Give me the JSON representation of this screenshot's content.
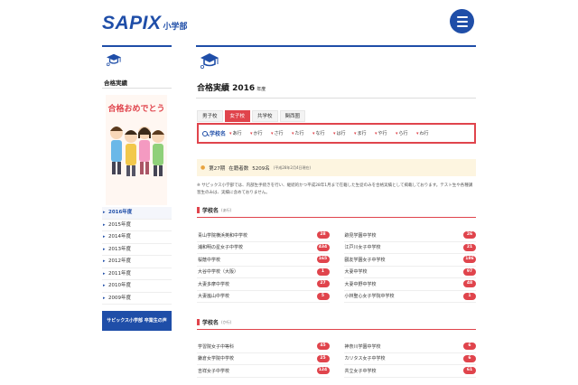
{
  "header": {
    "logo_main": "SAPIX",
    "logo_sub": "小学部",
    "menu_icon": "hamburger-menu-icon"
  },
  "sidebar": {
    "icon": "graduation-cap-icon",
    "title": "合格実績",
    "banner_text": "合格おめでとう",
    "years": [
      {
        "label": "2016年度",
        "active": true
      },
      {
        "label": "2015年度"
      },
      {
        "label": "2014年度"
      },
      {
        "label": "2013年度"
      },
      {
        "label": "2012年度"
      },
      {
        "label": "2011年度"
      },
      {
        "label": "2010年度"
      },
      {
        "label": "2009年度"
      }
    ],
    "voice_button": "サピックス小学部 卒業生の声"
  },
  "main": {
    "icon": "graduation-cap-icon",
    "title": "合格実績 2016",
    "title_suffix": "年度",
    "tabs": [
      {
        "label": "男子校"
      },
      {
        "label": "女子校",
        "active": true
      },
      {
        "label": "共学校"
      },
      {
        "label": "関西圏"
      }
    ],
    "search_label": "学校名",
    "rows": [
      "あ行",
      "か行",
      "さ行",
      "た行",
      "な行",
      "は行",
      "ま行",
      "や行",
      "ら行",
      "わ行"
    ],
    "info": {
      "term": "第27期",
      "enrolled_label": "在籍者数",
      "enrolled_count": "5209名",
      "note": "(平成28年2月4日現在)"
    },
    "description": "※ サピックス小学部では、内部生手続きを行い、継続的かつ平成28年1月まで在籍した生徒のみを合格実績として掲載しております。テスト生や各種講習生のみは、実績に含めておりません。",
    "sections": [
      {
        "title": "学校名",
        "row": "(あ行)",
        "entries": [
          {
            "name": "青山学院横浜英和中学校",
            "count": "28"
          },
          {
            "name": "跡見学園中学校",
            "count": "26"
          },
          {
            "name": "浦和明の星女子中学校",
            "count": "434"
          },
          {
            "name": "江戸川女子中学校",
            "count": "21"
          },
          {
            "name": "桜蔭中学校",
            "count": "165"
          },
          {
            "name": "鷗友学園女子中学校",
            "count": "186"
          },
          {
            "name": "大谷中学校（大阪）",
            "count": "1"
          },
          {
            "name": "大妻中学校",
            "count": "97"
          },
          {
            "name": "大妻多摩中学校",
            "count": "27"
          },
          {
            "name": "大妻中野中学校",
            "count": "48"
          },
          {
            "name": "大妻嵐山中学校",
            "count": "5"
          },
          {
            "name": "小林聖心女子学院中学校",
            "count": "1"
          }
        ]
      },
      {
        "title": "学校名",
        "row": "(か行)",
        "entries": [
          {
            "name": "学習院女子中等科",
            "count": "45"
          },
          {
            "name": "神奈川学園中学校",
            "count": "6"
          },
          {
            "name": "鎌倉女学院中学校",
            "count": "25"
          },
          {
            "name": "カリタス女子中学校",
            "count": "6"
          },
          {
            "name": "吉祥女子中学校",
            "count": "124"
          },
          {
            "name": "共立女子中学校",
            "count": "61"
          }
        ]
      }
    ]
  },
  "colors": {
    "brand_blue": "#1f4ea8",
    "accent_red": "#e0444c",
    "info_bg": "#fdf5e0"
  }
}
